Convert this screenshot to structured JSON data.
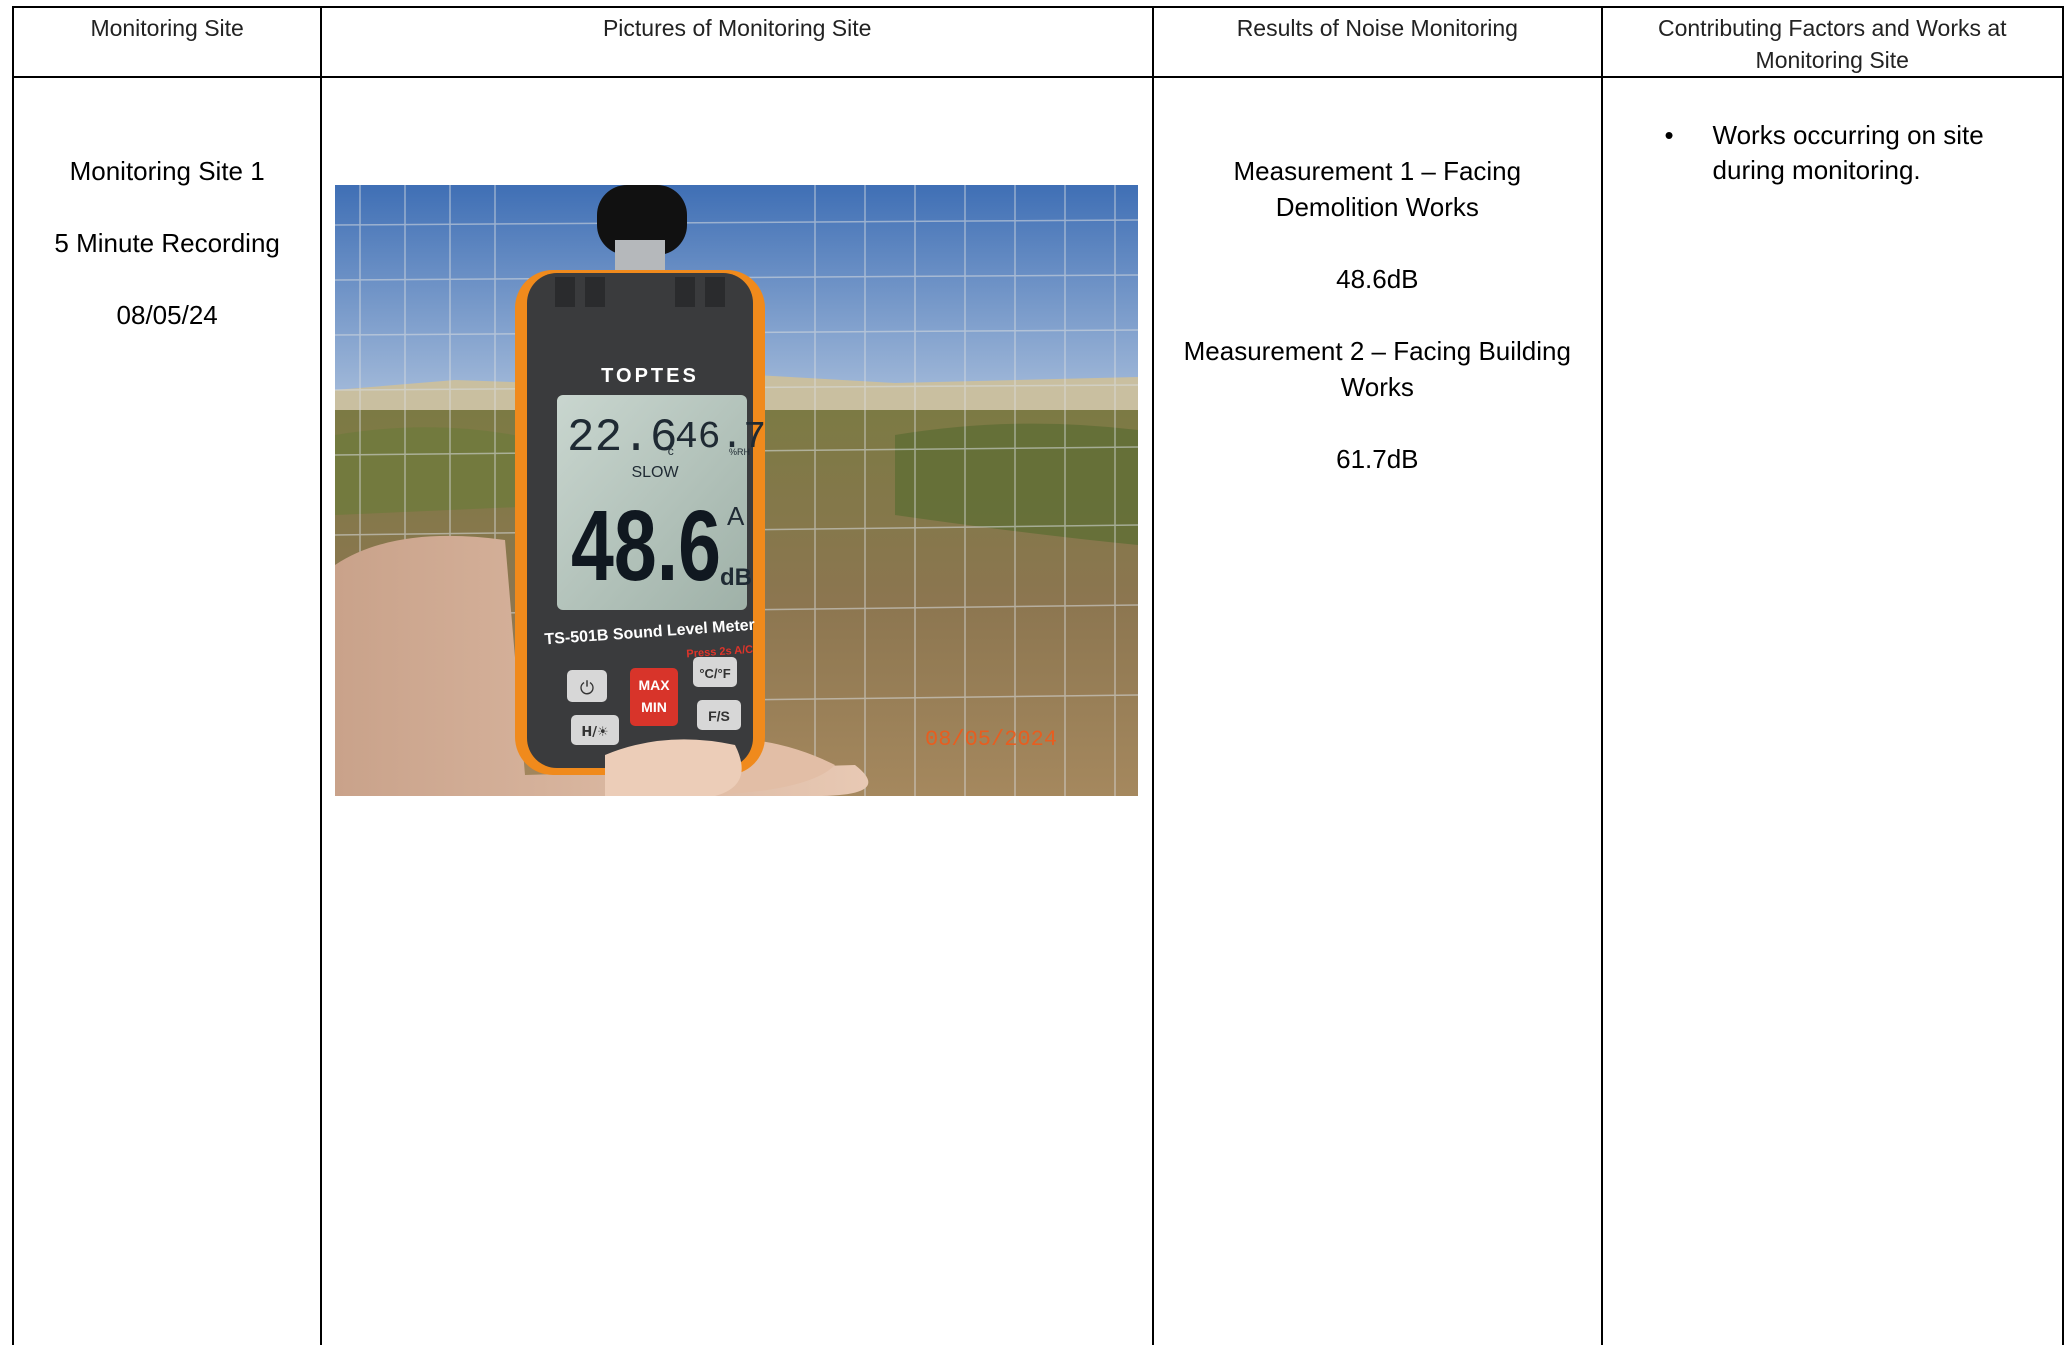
{
  "headers": {
    "col1": "Monitoring Site",
    "col2": "Pictures of Monitoring Site",
    "col3": "Results of Noise Monitoring",
    "col4": "Contributing Factors and Works at Monitoring Site"
  },
  "site": {
    "name": "Monitoring Site 1",
    "duration": "5 Minute Recording",
    "date": "08/05/24"
  },
  "photo": {
    "brand": "TOPTES",
    "temp": "22.6",
    "temp_unit": "°c",
    "humidity": "46.7",
    "humidity_unit": "%RH",
    "mode": "SLOW",
    "reading": "48.6",
    "weighting": "A",
    "unit": "dB",
    "model": "TS-501B Sound Level Meter",
    "hint": "Press 2s A/C",
    "btn_max": "MAX",
    "btn_min": "MIN",
    "btn_cf": "°C/°F",
    "btn_fs": "F/S",
    "btn_h": "H/☀",
    "timestamp": "08/05/2024",
    "colors": {
      "sky": "#5b86c4",
      "ground": "#8a7447",
      "meter": "#3a3b3d",
      "accent": "#f08a1c",
      "lcd": "#b8c7c0",
      "red_button": "#d8342a",
      "stamp": "#ef5a1a"
    }
  },
  "results": {
    "m1_label": "Measurement 1 – Facing Demolition Works",
    "m1_value": "48.6dB",
    "m2_label": "Measurement 2 – Facing Building Works",
    "m2_value": "61.7dB"
  },
  "factors": {
    "items": [
      "Works occurring on site during monitoring."
    ]
  }
}
